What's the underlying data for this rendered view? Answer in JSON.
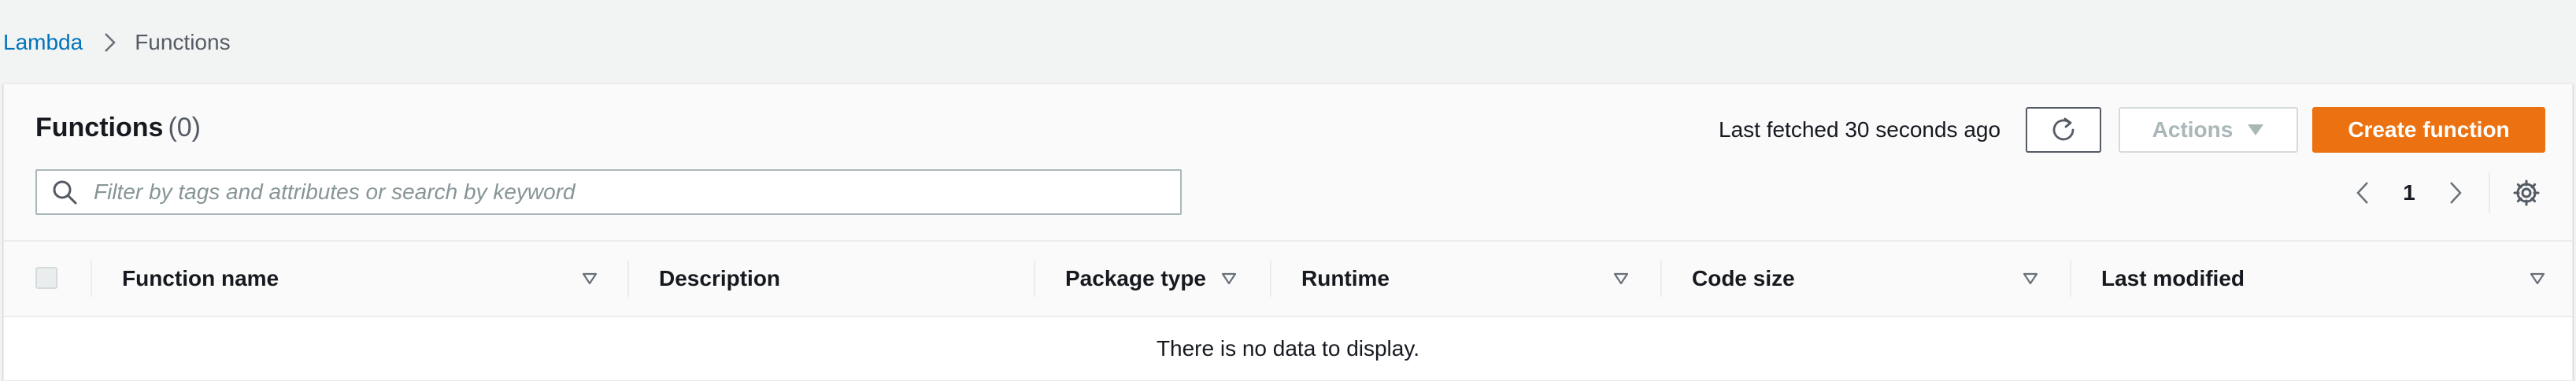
{
  "breadcrumb": {
    "root": "Lambda",
    "current": "Functions"
  },
  "panel": {
    "title": "Functions",
    "count": "(0)",
    "last_fetched": "Last fetched 30 seconds ago",
    "actions_label": "Actions",
    "create_label": "Create function"
  },
  "search": {
    "placeholder": "Filter by tags and attributes or search by keyword",
    "value": ""
  },
  "pagination": {
    "current_page": "1"
  },
  "table": {
    "columns": [
      {
        "label": "Function name"
      },
      {
        "label": "Description"
      },
      {
        "label": "Package type"
      },
      {
        "label": "Runtime"
      },
      {
        "label": "Code size"
      },
      {
        "label": "Last modified"
      }
    ],
    "empty_message": "There is no data to display."
  },
  "colors": {
    "link": "#0073bb",
    "primary": "#ec7211",
    "disabled": "#aab7b8",
    "border": "#eaeded"
  },
  "icons": {
    "breadcrumb_separator": "chevron-right-icon",
    "refresh": "refresh-icon",
    "actions": "caret-down-icon",
    "search": "search-icon",
    "prev": "chevron-left-icon",
    "next": "chevron-right-icon",
    "settings": "gear-icon",
    "sort": "sort-caret-down-icon"
  }
}
